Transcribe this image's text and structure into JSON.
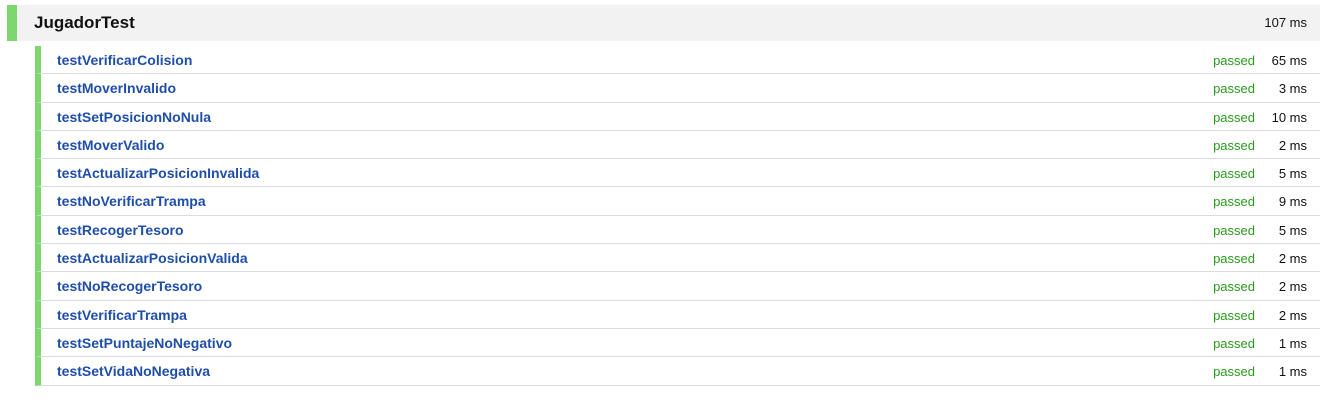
{
  "colors": {
    "accent_passed": "#7ed66f",
    "passed_text": "#2a9a1c",
    "link": "#1f4ea8",
    "header_bg": "#f2f2f2"
  },
  "suite": {
    "name": "JugadorTest",
    "duration": "107 ms"
  },
  "tests": [
    {
      "name": "testVerificarColision",
      "status": "passed",
      "duration": "65 ms"
    },
    {
      "name": "testMoverInvalido",
      "status": "passed",
      "duration": "3 ms"
    },
    {
      "name": "testSetPosicionNoNula",
      "status": "passed",
      "duration": "10 ms"
    },
    {
      "name": "testMoverValido",
      "status": "passed",
      "duration": "2 ms"
    },
    {
      "name": "testActualizarPosicionInvalida",
      "status": "passed",
      "duration": "5 ms"
    },
    {
      "name": "testNoVerificarTrampa",
      "status": "passed",
      "duration": "9 ms"
    },
    {
      "name": "testRecogerTesoro",
      "status": "passed",
      "duration": "5 ms"
    },
    {
      "name": "testActualizarPosicionValida",
      "status": "passed",
      "duration": "2 ms"
    },
    {
      "name": "testNoRecogerTesoro",
      "status": "passed",
      "duration": "2 ms"
    },
    {
      "name": "testVerificarTrampa",
      "status": "passed",
      "duration": "2 ms"
    },
    {
      "name": "testSetPuntajeNoNegativo",
      "status": "passed",
      "duration": "1 ms"
    },
    {
      "name": "testSetVidaNoNegativa",
      "status": "passed",
      "duration": "1 ms"
    }
  ]
}
